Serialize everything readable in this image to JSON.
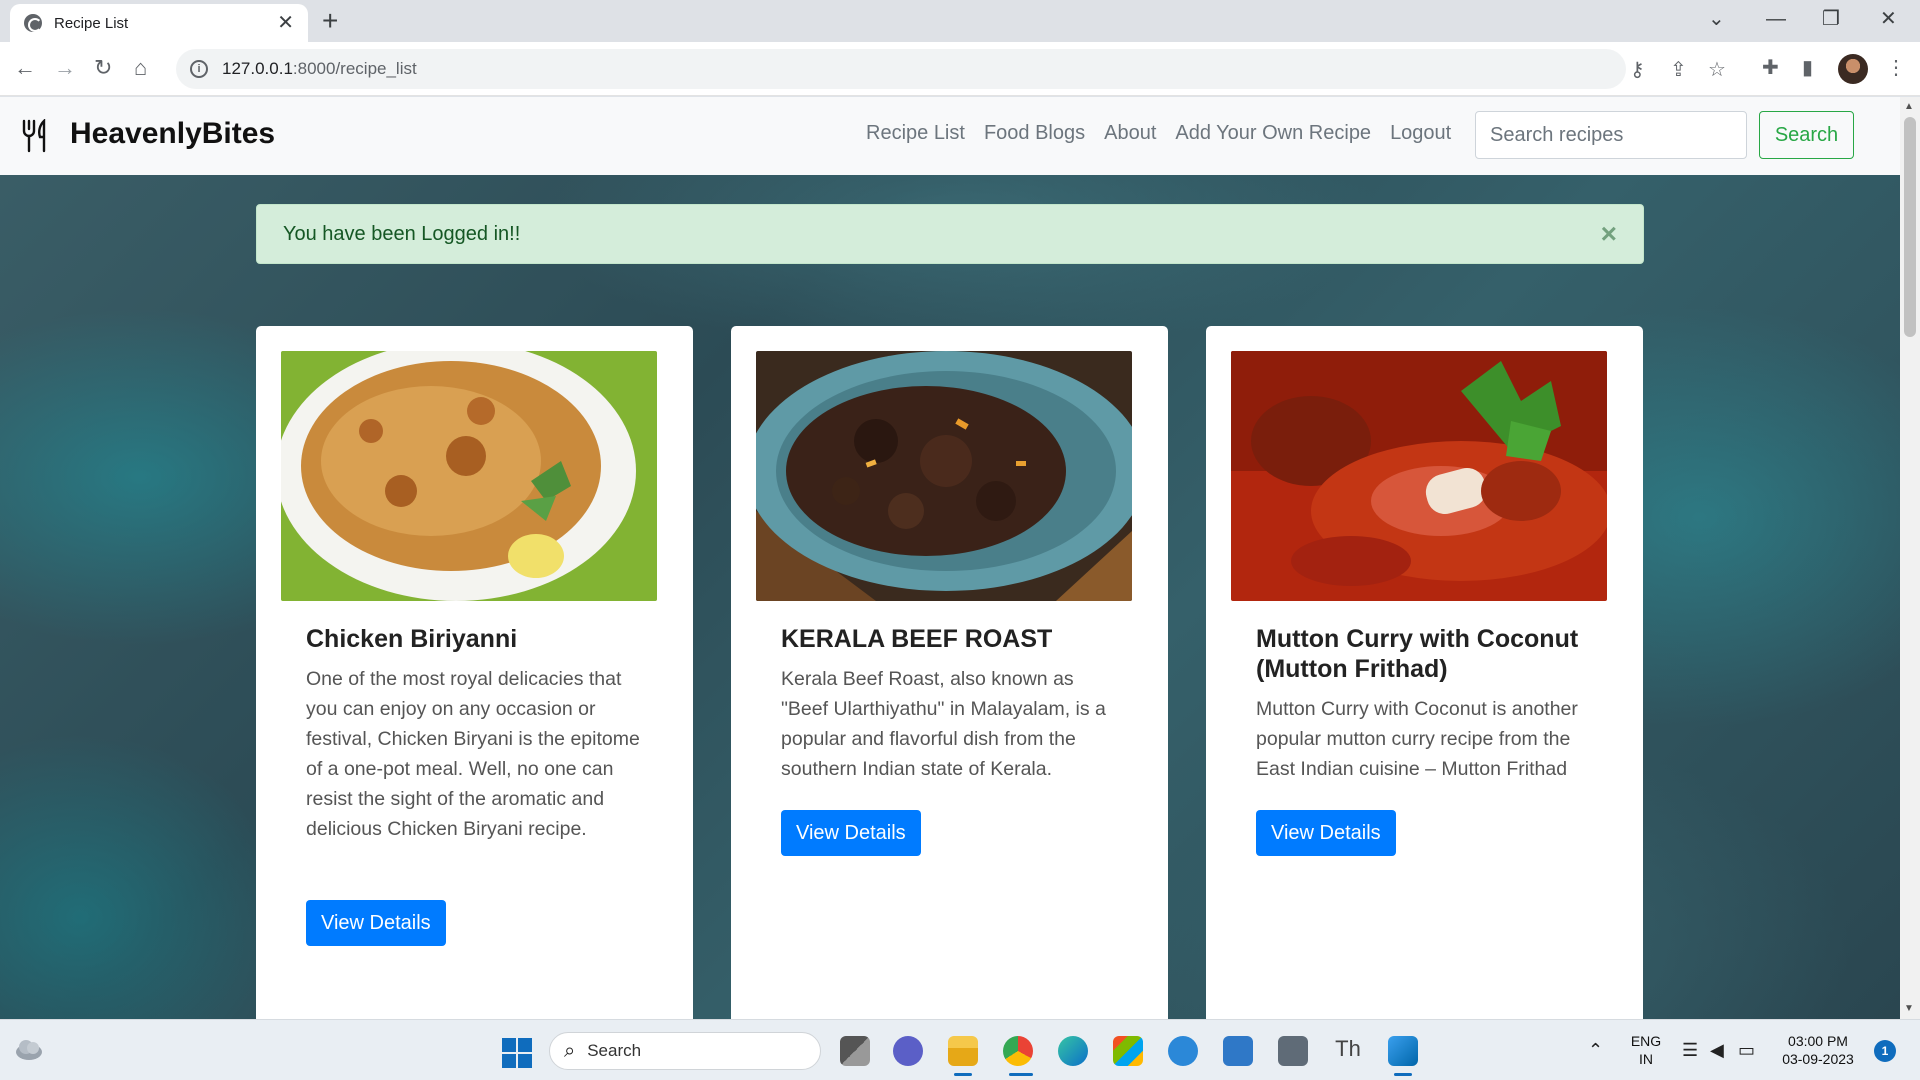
{
  "browser": {
    "tab_title": "Recipe List",
    "url_host": "127.0.0.1",
    "url_path": ":8000/recipe_list"
  },
  "site": {
    "brand": "HeavenlyBites",
    "nav": [
      "Recipe List",
      "Food Blogs",
      "About",
      "Add Your Own Recipe",
      "Logout"
    ],
    "search_placeholder": "Search recipes",
    "search_button": "Search",
    "alert": "You have been Logged in!!",
    "alert_close": "×"
  },
  "recipes": [
    {
      "title": "Chicken Biriyanni",
      "description": "One of the most royal delicacies that you can enjoy on any occasion or festival, Chicken Biryani is the epitome of a one-pot meal. Well, no one can resist the sight of the aromatic and delicious Chicken Biryani recipe.",
      "button": "View Details",
      "image": "chicken-biryani-photo"
    },
    {
      "title": "KERALA BEEF ROAST",
      "description": "Kerala Beef Roast, also known as \"Beef Ularthiyathu\" in Malayalam, is a popular and flavorful dish from the southern Indian state of Kerala.",
      "button": "View Details",
      "image": "beef-roast-photo"
    },
    {
      "title": "Mutton Curry with Coconut (Mutton Frithad)",
      "description": "Mutton Curry with Coconut is another popular mutton curry recipe from the East Indian cuisine – Mutton Frithad",
      "button": "View Details",
      "image": "mutton-curry-photo"
    }
  ],
  "taskbar": {
    "search_label": "Search",
    "lang_top": "ENG",
    "lang_bottom": "IN",
    "time": "03:00 PM",
    "date": "03-09-2023",
    "notifications": "1"
  },
  "colors": {
    "primary": "#007bff",
    "success": "#28a745",
    "alert_bg": "#d4edda",
    "alert_text": "#155724"
  }
}
